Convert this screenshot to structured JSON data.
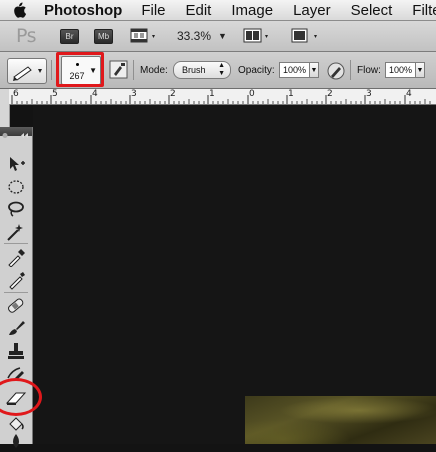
{
  "menubar": {
    "app_name": "Photoshop",
    "items": [
      "File",
      "Edit",
      "Image",
      "Layer",
      "Select",
      "Filter"
    ]
  },
  "appbar": {
    "logo": "Ps",
    "bridge_label": "Br",
    "minibridge_label": "Mb",
    "zoom": "33.3%"
  },
  "options": {
    "brush_size": "267",
    "mode_label": "Mode:",
    "mode_value": "Brush",
    "opacity_label": "Opacity:",
    "opacity_value": "100%",
    "flow_label": "Flow:",
    "flow_value": "100%"
  },
  "ruler": {
    "numbers": [
      "6",
      "5",
      "4",
      "3",
      "2",
      "1",
      "0",
      "1",
      "2",
      "3",
      "4"
    ]
  },
  "colors": {
    "highlight": "#e0181b",
    "canvas": "#151515"
  }
}
